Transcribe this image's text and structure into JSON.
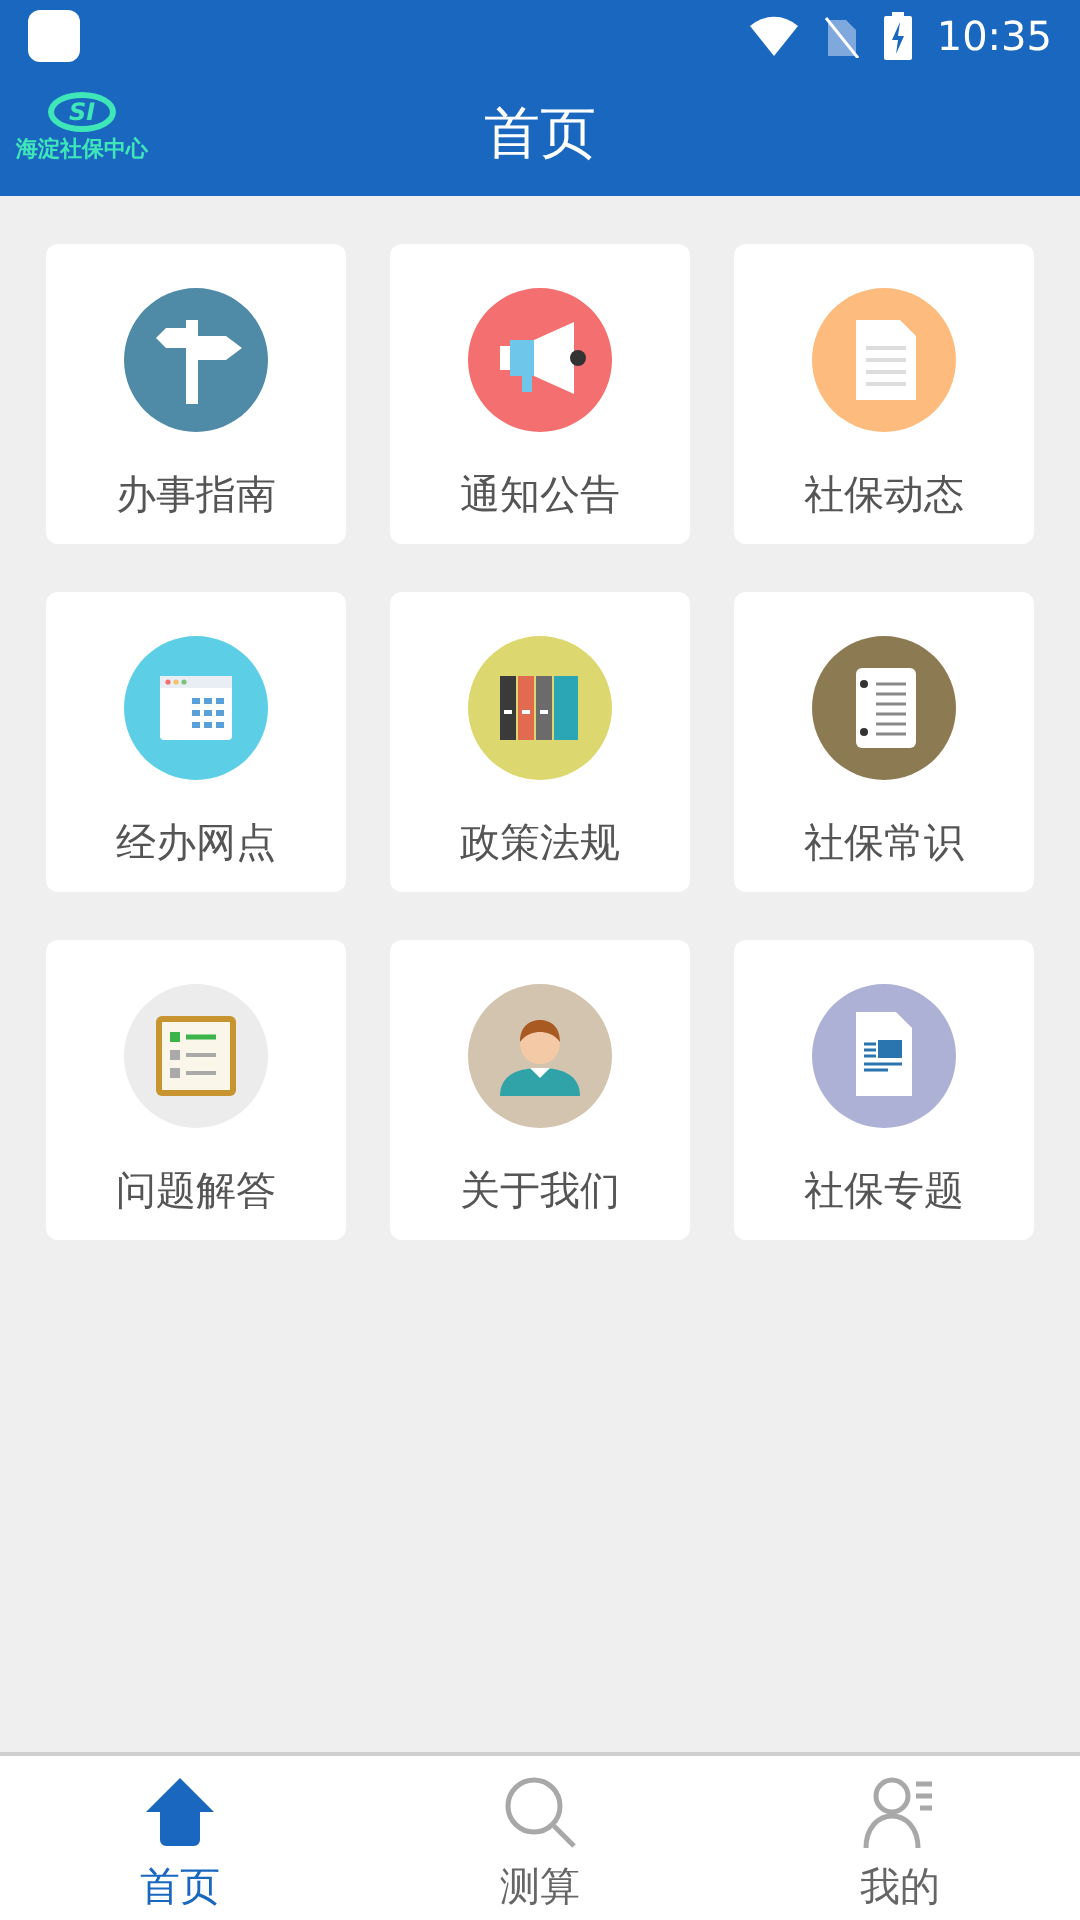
{
  "status_bar": {
    "time": "10:35"
  },
  "header": {
    "logo_mark": "SI",
    "logo_text": "海淀社保中心",
    "title": "首页"
  },
  "tiles": [
    {
      "label": "办事指南",
      "color": "#4f8aa6"
    },
    {
      "label": "通知公告",
      "color": "#f46f6f"
    },
    {
      "label": "社保动态",
      "color": "#fdbb7d"
    },
    {
      "label": "经办网点",
      "color": "#5ccfe6"
    },
    {
      "label": "政策法规",
      "color": "#dcd86f"
    },
    {
      "label": "社保常识",
      "color": "#8c7a52"
    },
    {
      "label": "问题解答",
      "color": "#ececec"
    },
    {
      "label": "关于我们",
      "color": "#d2c4ae"
    },
    {
      "label": "社保专题",
      "color": "#aeb1d6"
    }
  ],
  "tab_bar": [
    {
      "label": "首页",
      "selected": true
    },
    {
      "label": "测算",
      "selected": false
    },
    {
      "label": "我的",
      "selected": false
    }
  ]
}
